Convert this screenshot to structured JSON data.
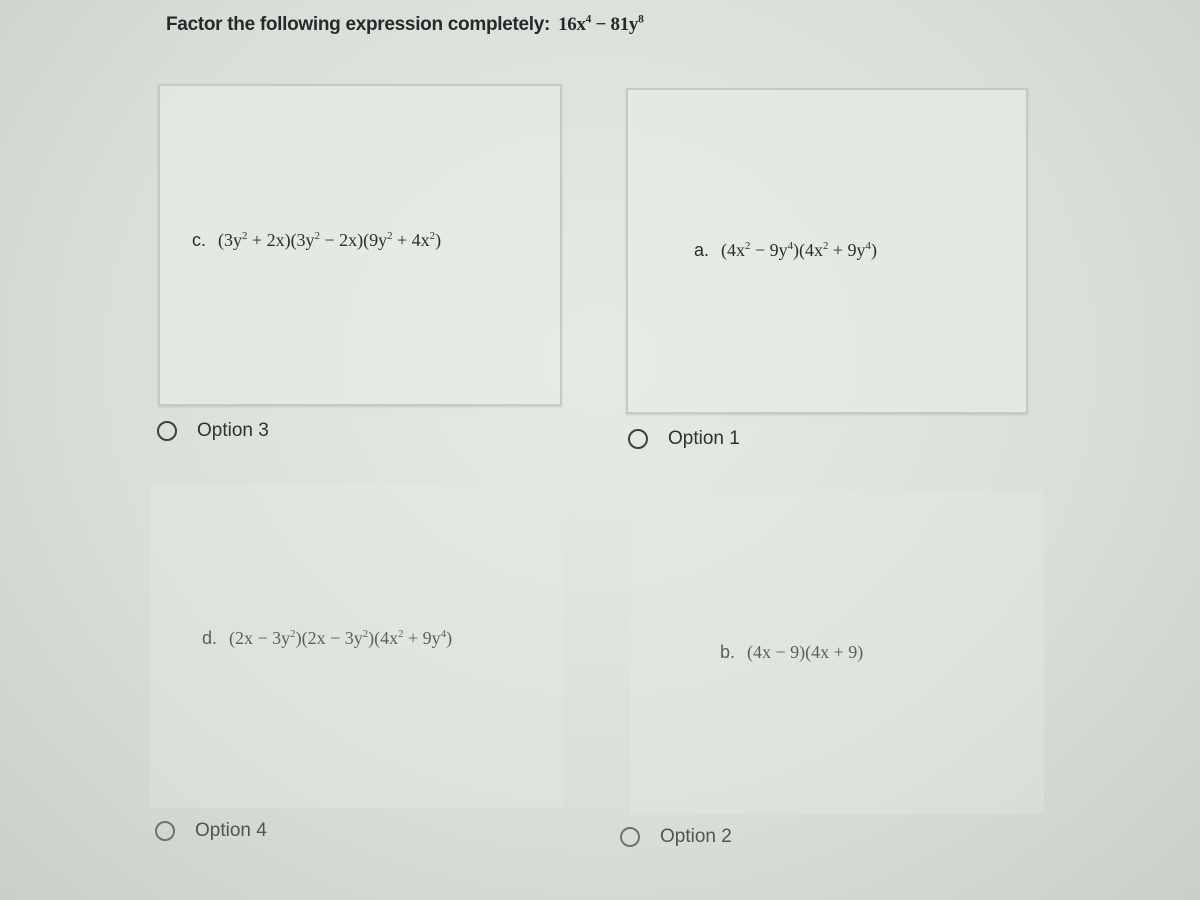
{
  "question": {
    "prompt": "Factor the following expression completely:",
    "expression_html": "16x<sup>4</sup> &minus; 81y<sup>8</sup>"
  },
  "choices": [
    {
      "letter": "c.",
      "expression_html": "(3y<sup>2</sup> + 2x)(3y<sup>2</sup> &minus; 2x)(9y<sup>2</sup> + 4x<sup>2</sup>)",
      "option_label": "Option 3",
      "selected": false
    },
    {
      "letter": "a.",
      "expression_html": "(4x<sup>2</sup> &minus; 9y<sup>4</sup>)(4x<sup>2</sup> + 9y<sup>4</sup>)",
      "option_label": "Option 1",
      "selected": false
    },
    {
      "letter": "d.",
      "expression_html": "(2x &minus; 3y<sup>2</sup>)(2x &minus; 3y<sup>2</sup>)(4x<sup>2</sup> + 9y<sup>4</sup>)",
      "option_label": "Option 4",
      "selected": false
    },
    {
      "letter": "b.",
      "expression_html": "(4x &minus; 9)(4x + 9)",
      "option_label": "Option 2",
      "selected": false
    }
  ]
}
